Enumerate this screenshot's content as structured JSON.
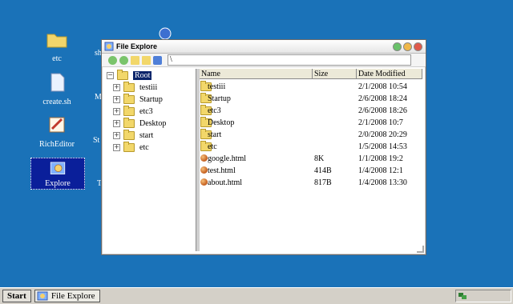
{
  "desktop": {
    "icons": [
      {
        "label": "etc",
        "icon": "folder-icon"
      },
      {
        "label": "create.sh",
        "icon": "file-icon"
      },
      {
        "label": "RichEditor",
        "icon": "pen-icon"
      },
      {
        "label": "Explore",
        "icon": "explore-icon"
      }
    ],
    "partial": [
      {
        "label": "sh"
      },
      {
        "label": "M"
      },
      {
        "label": "St"
      },
      {
        "label": "T"
      }
    ]
  },
  "window": {
    "title": "File Explore",
    "address": "\\",
    "tree": {
      "root": "Root",
      "items": [
        {
          "label": "testiii"
        },
        {
          "label": "Startup"
        },
        {
          "label": "etc3"
        },
        {
          "label": "Desktop"
        },
        {
          "label": "start"
        },
        {
          "label": "etc"
        }
      ]
    },
    "list": {
      "columns": [
        "Name",
        "Size",
        "Date Modified"
      ],
      "rows": [
        {
          "name": "testiii",
          "size": "",
          "date": "2/1/2008 10:54",
          "type": "folder"
        },
        {
          "name": "Startup",
          "size": "",
          "date": "2/6/2008 18:24",
          "type": "folder"
        },
        {
          "name": "etc3",
          "size": "",
          "date": "2/6/2008 18:26",
          "type": "folder"
        },
        {
          "name": "Desktop",
          "size": "",
          "date": "2/1/2008 10:7",
          "type": "folder"
        },
        {
          "name": "start",
          "size": "",
          "date": "2/0/2008 20:29",
          "type": "folder"
        },
        {
          "name": "etc",
          "size": "",
          "date": "1/5/2008 14:53",
          "type": "folder"
        },
        {
          "name": "google.html",
          "size": "8K",
          "date": "1/1/2008 19:2",
          "type": "html"
        },
        {
          "name": "test.html",
          "size": "414B",
          "date": "1/4/2008 12:1",
          "type": "html"
        },
        {
          "name": "about.html",
          "size": "817B",
          "date": "1/4/2008 13:30",
          "type": "html"
        }
      ]
    }
  },
  "taskbar": {
    "start": "Start",
    "task": "File Explore"
  },
  "colors": {
    "desktop": "#1a72b8",
    "selection": "#0a246a",
    "folder": "#f2d76a"
  }
}
